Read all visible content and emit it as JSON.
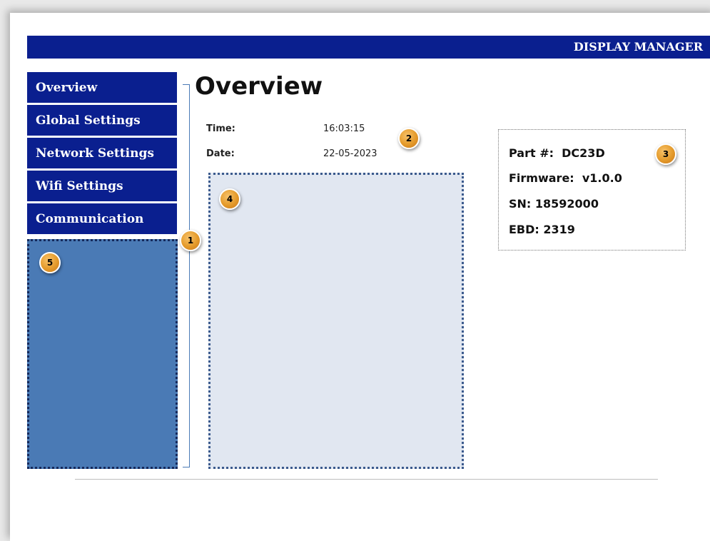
{
  "header": {
    "title": "DISPLAY MANAGER"
  },
  "nav": {
    "items": [
      {
        "label": "Overview"
      },
      {
        "label": "Global Settings"
      },
      {
        "label": "Network Settings"
      },
      {
        "label": "Wifi Settings"
      },
      {
        "label": "Communication"
      }
    ]
  },
  "main": {
    "title": "Overview",
    "time_label": "Time:",
    "time_value": "16:03:15",
    "date_label": "Date:",
    "date_value": "22-05-2023"
  },
  "device": {
    "part": "Part #:  DC23D",
    "firmware": "Firmware:  v1.0.0",
    "sn": "SN: 18592000",
    "ebd": "EBD: 2319"
  },
  "callouts": [
    "1",
    "2",
    "3",
    "4",
    "5"
  ],
  "colors": {
    "header_bg": "#0a1f8f",
    "nav_bg": "#0a1f8f",
    "nav_panel_bg": "#4a7ab5",
    "main_panel_bg": "#e1e7f1",
    "callout_badge": "#e49a2a"
  }
}
